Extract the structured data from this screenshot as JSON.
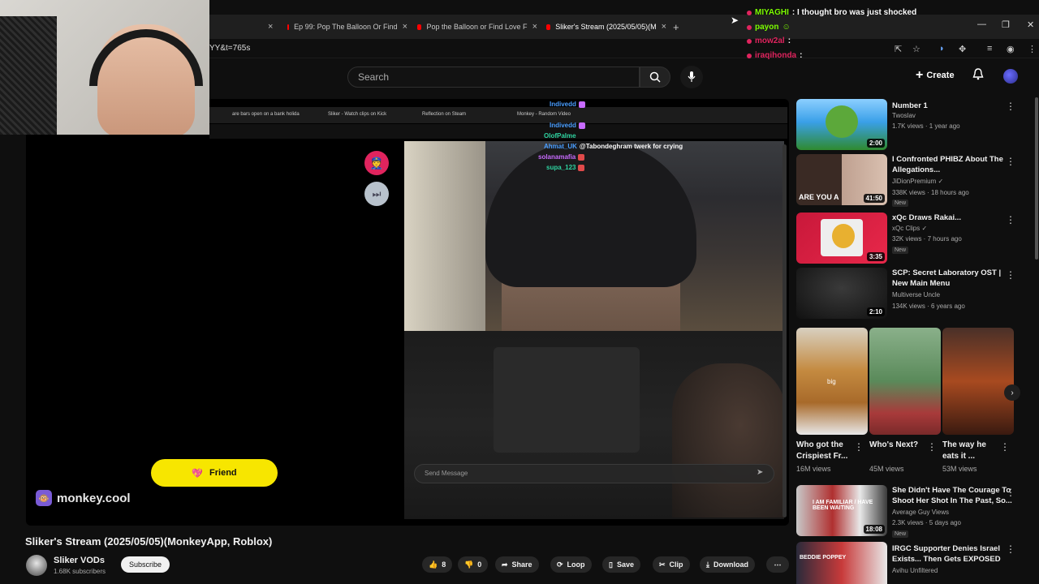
{
  "browser": {
    "tabs": [
      {
        "label": "Ep 99: Pop The Balloon Or Find",
        "active": false
      },
      {
        "label": "Pop the Balloon or Find Love F",
        "active": false
      },
      {
        "label": "Sliker's Stream (2025/05/05)(M",
        "active": true
      }
    ],
    "url_fragment": "YY&t=765s"
  },
  "header": {
    "search_placeholder": "Search",
    "create_label": "Create"
  },
  "top_chat": [
    {
      "user": "MIYAGHI",
      "message": ": I thought bro was just shocked",
      "color": "#7CFC00"
    },
    {
      "user": "payon",
      "message": ":",
      "color": "#7CFC00"
    },
    {
      "user": "mow2al",
      "message": ":",
      "color": "#e0245e"
    },
    {
      "user": "iraqihonda",
      "message": ":",
      "color": "#e0245e"
    }
  ],
  "player": {
    "inner_tabs": [
      "are bars open on a bank holida",
      "Sliker - Watch clips on Kick",
      "Reflection on Steam",
      "Monkey - Random Video"
    ],
    "overlay_chat": [
      {
        "user": "Indivedd",
        "message": "",
        "color": "#4a9eff"
      },
      {
        "user": "Indivedd",
        "message": "",
        "color": "#4a9eff"
      },
      {
        "user": "OlofPalme",
        "message": "",
        "color": "#2ed3a0"
      },
      {
        "user": "Ahmat_UK",
        "message": "@Tabondeghram twerk for crying",
        "color": "#4a9eff"
      },
      {
        "user": "solanamafia",
        "message": "",
        "color": "#c86bff"
      },
      {
        "user": "supa_123",
        "message": "",
        "color": "#2ed3a0"
      }
    ],
    "send_placeholder": "Send Message",
    "friend_label": "Friend",
    "brand": "monkey.cool"
  },
  "video": {
    "title": "Sliker's Stream (2025/05/05)(MonkeyApp, Roblox)",
    "channel": "Sliker VODs",
    "subscribers": "1.68K subscribers",
    "subscribe_label": "Subscribe",
    "likes": "8",
    "dislikes": "0",
    "actions": {
      "share": "Share",
      "loop": "Loop",
      "save": "Save",
      "clip": "Clip",
      "download": "Download"
    }
  },
  "recommendations": [
    {
      "title": "Number 1",
      "channel": "Twoslav",
      "meta": "1.7K views · 1 year ago",
      "duration": "2:00",
      "new": false,
      "verified": false
    },
    {
      "title": "I Confronted PHIBZ About The Allegations...",
      "channel": "JiDionPremium",
      "meta": "338K views · 18 hours ago",
      "duration": "41:50",
      "new": true,
      "verified": true
    },
    {
      "title": "xQc Draws Rakai...",
      "channel": "xQc Clips",
      "meta": "32K views · 7 hours ago",
      "duration": "3:35",
      "new": true,
      "verified": true
    },
    {
      "title": "SCP: Secret Laboratory OST | New Main Menu",
      "channel": "Multiverse Uncle",
      "meta": "134K views · 6 years ago",
      "duration": "2:10",
      "new": false,
      "verified": false
    },
    {
      "title": "She Didn't Have The Courage To Shoot Her Shot In The Past, So...",
      "channel": "Average Guy Views",
      "meta": "2.3K views · 5 days ago",
      "duration": "18:08",
      "new": true,
      "verified": false
    },
    {
      "title": "IRGC Supporter Denies Israel Exists... Then Gets EXPOSED",
      "channel": "Avihu Unfiltered",
      "meta": "",
      "duration": "",
      "new": false,
      "verified": false
    }
  ],
  "thumb_text": {
    "rec2": "ARE YOU A",
    "rec5": "I AM FAMILIAR / HAVE BEEN WAITING",
    "rec6": "BEDDIE POPPEY",
    "short1": "big"
  },
  "shorts": [
    {
      "title": "Who got the Crispiest Fr...",
      "views": "16M views"
    },
    {
      "title": "Who's Next?",
      "views": "45M views"
    },
    {
      "title": "The way he eats it ...",
      "views": "53M views"
    }
  ],
  "colors": {
    "accent_yellow": "#f7e600",
    "yt_red": "#ff0000",
    "bg": "#0f0f0f"
  }
}
